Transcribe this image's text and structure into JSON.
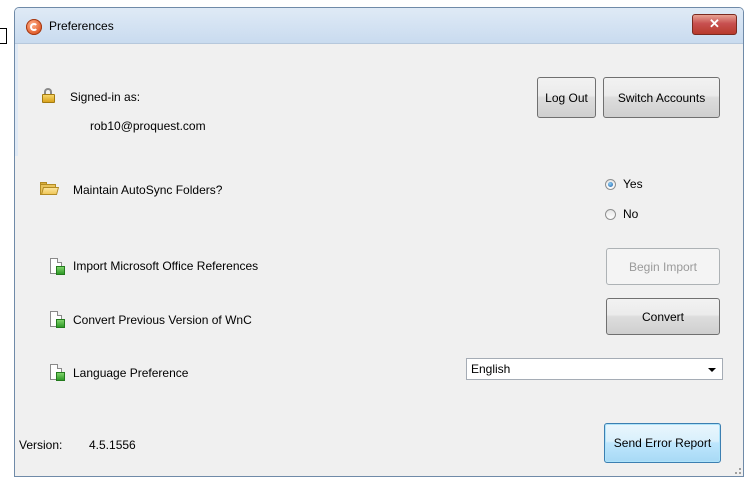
{
  "window": {
    "title": "Preferences",
    "close_glyph": "✕"
  },
  "account": {
    "label": "Signed-in as:",
    "email": "rob10@proquest.com",
    "logout_label": "Log Out",
    "switch_label": "Switch Accounts"
  },
  "autosync": {
    "label": "Maintain AutoSync Folders?",
    "options": [
      {
        "label": "Yes",
        "checked": true
      },
      {
        "label": "No",
        "checked": false
      }
    ]
  },
  "import_refs": {
    "label": "Import Microsoft Office References",
    "button_label": "Begin Import",
    "button_enabled": false
  },
  "convert": {
    "label": "Convert Previous Version of WnC",
    "button_label": "Convert"
  },
  "language": {
    "label": "Language Preference",
    "selected": "English"
  },
  "footer": {
    "version_label": "Version:",
    "version_value": "4.5.1556",
    "error_report_label": "Send Error Report"
  },
  "icons": {
    "account": "lock-icon",
    "autosync": "folder-icon",
    "import": "document-icon",
    "convert": "document-icon",
    "language": "document-icon"
  },
  "colors": {
    "titlebar": "#c9dbef",
    "close_button": "#c75050",
    "client_bg": "#f0f0f0",
    "focus_border": "#3c7fb1"
  }
}
